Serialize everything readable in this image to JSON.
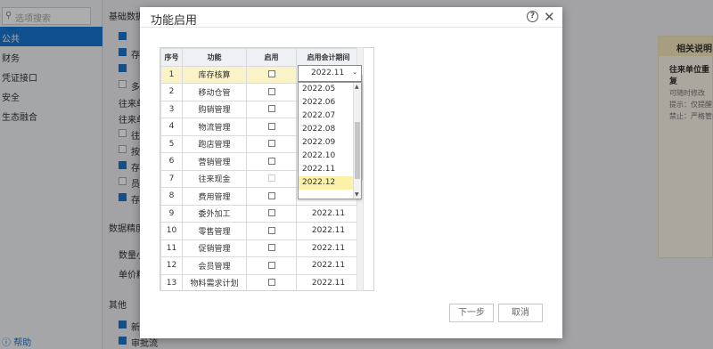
{
  "background": {
    "search_placeholder": "选项搜索",
    "nav": [
      {
        "label": "公共",
        "active": true
      },
      {
        "label": "财务",
        "active": false
      },
      {
        "label": "凭证接口",
        "active": false
      },
      {
        "label": "安全",
        "active": false
      },
      {
        "label": "生态融合",
        "active": false
      }
    ],
    "help_label": "帮助",
    "sections": {
      "basic": "基础数据",
      "precision": "数据精度",
      "other": "其他"
    },
    "labels": {
      "cb1": "存",
      "cb2": "多",
      "wl1": "往来单",
      "wl2": "往来单",
      "cb3": "往",
      "cb4": "按",
      "cb5": "存",
      "cb6": "员",
      "cb7": "存",
      "qty": "数量小",
      "price": "单价精",
      "new": "新",
      "approve": "审批流"
    },
    "right_card": {
      "header": "相关说明",
      "title": "往来单位重复",
      "lines": [
        "可随时修改",
        "提示：仅提醒",
        "禁止：严格管控"
      ]
    }
  },
  "dialog": {
    "title": "功能启用",
    "table": {
      "headers": [
        "序号",
        "功能",
        "启用",
        "启用会计期间"
      ],
      "rows": [
        {
          "idx": "1",
          "name": "库存核算",
          "enabled": false,
          "period": "2022.11"
        },
        {
          "idx": "2",
          "name": "移动仓管",
          "enabled": false,
          "period": ""
        },
        {
          "idx": "3",
          "name": "购销管理",
          "enabled": false,
          "period": ""
        },
        {
          "idx": "4",
          "name": "物流管理",
          "enabled": false,
          "period": ""
        },
        {
          "idx": "5",
          "name": "跑店管理",
          "enabled": false,
          "period": ""
        },
        {
          "idx": "6",
          "name": "营销管理",
          "enabled": false,
          "period": ""
        },
        {
          "idx": "7",
          "name": "往来现金",
          "enabled": false,
          "period": ""
        },
        {
          "idx": "8",
          "name": "费用管理",
          "enabled": false,
          "period": ""
        },
        {
          "idx": "9",
          "name": "委外加工",
          "enabled": false,
          "period": "2022.11"
        },
        {
          "idx": "10",
          "name": "零售管理",
          "enabled": false,
          "period": "2022.11"
        },
        {
          "idx": "11",
          "name": "促销管理",
          "enabled": false,
          "period": "2022.11"
        },
        {
          "idx": "12",
          "name": "会员管理",
          "enabled": false,
          "period": "2022.11"
        },
        {
          "idx": "13",
          "name": "物料需求计划",
          "enabled": false,
          "period": "2022.11"
        }
      ]
    },
    "period_select": {
      "value": "2022.11",
      "options": [
        "2022.05",
        "2022.06",
        "2022.07",
        "2022.08",
        "2022.09",
        "2022.10",
        "2022.11",
        "2022.12"
      ],
      "highlighted": "2022.12"
    },
    "buttons": {
      "next": "下一步",
      "cancel": "取消"
    }
  }
}
